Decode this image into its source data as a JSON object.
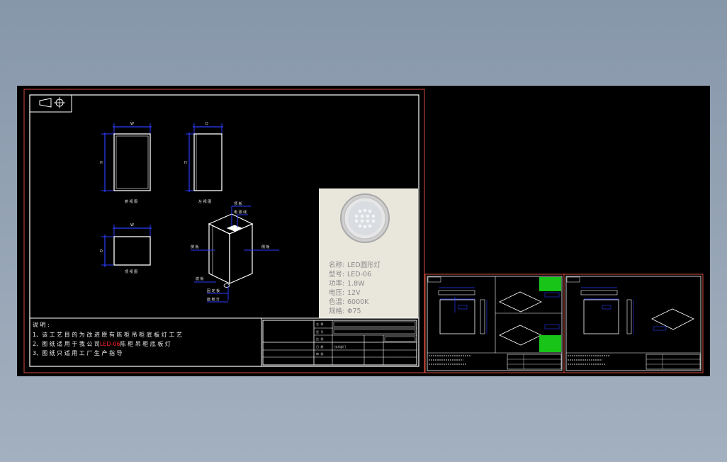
{
  "drawing": {
    "views": {
      "front_label": "俯 视 图",
      "side_label": "左 视 图",
      "bottom_label": "顶 视 图",
      "dim_w": "W",
      "dim_h": "H",
      "dim_d": "D"
    },
    "iso_labels": {
      "top_a": "顶  板",
      "top_b": "电 源 线",
      "left": "侧  板",
      "right": "侧  板",
      "bottom": "底  板",
      "callout1": "固 定 板",
      "callout2": "面 板 灯"
    },
    "product": {
      "name_label": "名称:",
      "name_value": "LED圆形灯",
      "model_label": "型号:",
      "model_value": "LED-06",
      "power_label": "功率:",
      "power_value": "1.8W",
      "voltage_label": "电压:",
      "voltage_value": "12V",
      "cct_label": "色温:",
      "cct_value": "6000K",
      "size_label": "规格:",
      "size_value": "Φ75"
    },
    "notes": {
      "title": "说 明 :",
      "line1": "1、该 工 艺 目 的 为 改 进 原 有 陈 柜 吊 柜 底 板 灯 工 艺",
      "line2_prefix": "2、图 纸 适 用 于 我 公 司",
      "line2_highlight": "LED-06",
      "line2_suffix": "陈 柜 吊 柜 底 板 灯",
      "line3": "3、图 纸 只 适 用 工 厂 生 产 指 导"
    },
    "title_block": {
      "r1": "名 称",
      "r2": "型 号",
      "r3": "比 例",
      "r4": "日 期",
      "r5": "审 核",
      "stamp": "技术部门"
    }
  },
  "colors": {
    "background": "#000000",
    "frame_outer": "#d24a3a",
    "frame_inner": "#ffffff",
    "dimension": "#2a3cff",
    "highlight": "#ff2020",
    "thumb_green": "#19c419"
  }
}
